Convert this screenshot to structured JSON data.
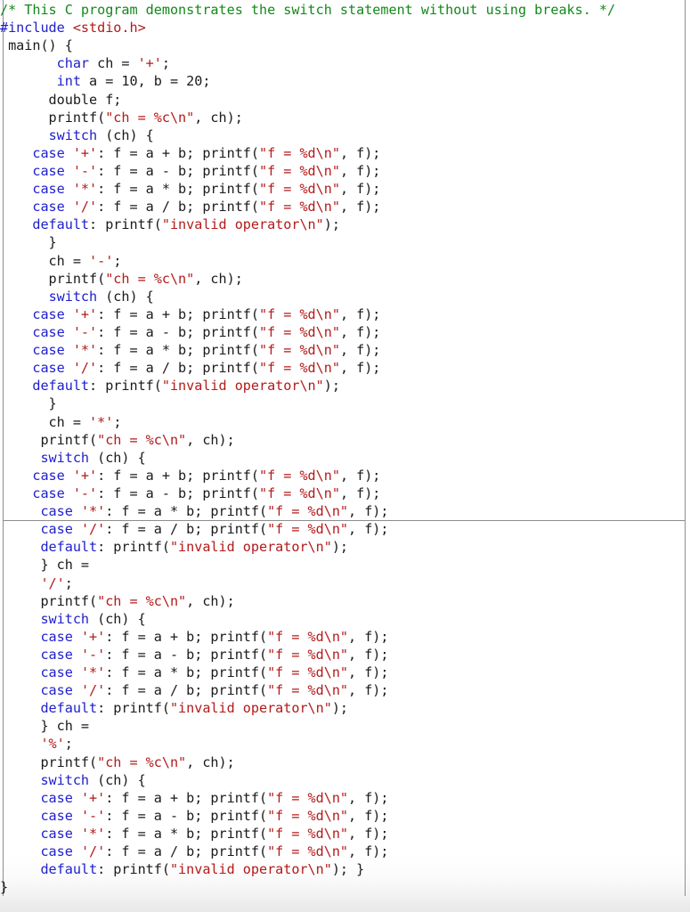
{
  "document": {
    "kind": "source-code-listing",
    "language": "C",
    "page_break_after_line_index": 28
  },
  "theme": {
    "background": "#ffffff",
    "foreground": "#1a1a1a",
    "keyword": "#2020cd",
    "string": "#b31a1a",
    "comment": "#13891a",
    "preprocessor": "#2020cd",
    "rule": "#8d8d8d"
  },
  "code": {
    "lines": [
      [
        {
          "t": "comment",
          "s": "/* This C program demonstrates the switch statement without using breaks. */"
        }
      ],
      [
        {
          "t": "pp",
          "s": "#include"
        },
        {
          "t": "plain",
          "s": " "
        },
        {
          "t": "str",
          "s": "<stdio.h>"
        }
      ],
      [
        {
          "t": "plain",
          "s": " main() {"
        }
      ],
      [
        {
          "t": "plain",
          "s": "       "
        },
        {
          "t": "kw",
          "s": "char"
        },
        {
          "t": "plain",
          "s": " ch = "
        },
        {
          "t": "str",
          "s": "'+'"
        },
        {
          "t": "plain",
          "s": ";"
        }
      ],
      [
        {
          "t": "plain",
          "s": "       "
        },
        {
          "t": "kw",
          "s": "int"
        },
        {
          "t": "plain",
          "s": " a = 10, b = 20;"
        }
      ],
      [
        {
          "t": "plain",
          "s": "      double f;"
        }
      ],
      [
        {
          "t": "plain",
          "s": "      printf("
        },
        {
          "t": "str",
          "s": "\"ch = %c\\n\""
        },
        {
          "t": "plain",
          "s": ", ch);"
        }
      ],
      [
        {
          "t": "plain",
          "s": "      "
        },
        {
          "t": "kw",
          "s": "switch"
        },
        {
          "t": "plain",
          "s": " (ch) {"
        }
      ],
      [
        {
          "t": "plain",
          "s": "    "
        },
        {
          "t": "kw",
          "s": "case"
        },
        {
          "t": "plain",
          "s": " "
        },
        {
          "t": "str",
          "s": "'+'"
        },
        {
          "t": "plain",
          "s": ": f = a + b; printf("
        },
        {
          "t": "str",
          "s": "\"f = %d\\n\""
        },
        {
          "t": "plain",
          "s": ", f);"
        }
      ],
      [
        {
          "t": "plain",
          "s": "    "
        },
        {
          "t": "kw",
          "s": "case"
        },
        {
          "t": "plain",
          "s": " "
        },
        {
          "t": "str",
          "s": "'-'"
        },
        {
          "t": "plain",
          "s": ": f = a - b; printf("
        },
        {
          "t": "str",
          "s": "\"f = %d\\n\""
        },
        {
          "t": "plain",
          "s": ", f);"
        }
      ],
      [
        {
          "t": "plain",
          "s": "    "
        },
        {
          "t": "kw",
          "s": "case"
        },
        {
          "t": "plain",
          "s": " "
        },
        {
          "t": "str",
          "s": "'*'"
        },
        {
          "t": "plain",
          "s": ": f = a * b; printf("
        },
        {
          "t": "str",
          "s": "\"f = %d\\n\""
        },
        {
          "t": "plain",
          "s": ", f);"
        }
      ],
      [
        {
          "t": "plain",
          "s": "    "
        },
        {
          "t": "kw",
          "s": "case"
        },
        {
          "t": "plain",
          "s": " "
        },
        {
          "t": "str",
          "s": "'/'"
        },
        {
          "t": "plain",
          "s": ": f = a / b; printf("
        },
        {
          "t": "str",
          "s": "\"f = %d\\n\""
        },
        {
          "t": "plain",
          "s": ", f);"
        }
      ],
      [
        {
          "t": "plain",
          "s": "    "
        },
        {
          "t": "kw",
          "s": "default"
        },
        {
          "t": "plain",
          "s": ": printf("
        },
        {
          "t": "str",
          "s": "\"invalid operator\\n\""
        },
        {
          "t": "plain",
          "s": ");"
        }
      ],
      [
        {
          "t": "plain",
          "s": "      }"
        }
      ],
      [
        {
          "t": "plain",
          "s": "      ch = "
        },
        {
          "t": "str",
          "s": "'-'"
        },
        {
          "t": "plain",
          "s": ";"
        }
      ],
      [
        {
          "t": "plain",
          "s": "      printf("
        },
        {
          "t": "str",
          "s": "\"ch = %c\\n\""
        },
        {
          "t": "plain",
          "s": ", ch);"
        }
      ],
      [
        {
          "t": "plain",
          "s": "      "
        },
        {
          "t": "kw",
          "s": "switch"
        },
        {
          "t": "plain",
          "s": " (ch) {"
        }
      ],
      [
        {
          "t": "plain",
          "s": "    "
        },
        {
          "t": "kw",
          "s": "case"
        },
        {
          "t": "plain",
          "s": " "
        },
        {
          "t": "str",
          "s": "'+'"
        },
        {
          "t": "plain",
          "s": ": f = a + b; printf("
        },
        {
          "t": "str",
          "s": "\"f = %d\\n\""
        },
        {
          "t": "plain",
          "s": ", f);"
        }
      ],
      [
        {
          "t": "plain",
          "s": "    "
        },
        {
          "t": "kw",
          "s": "case"
        },
        {
          "t": "plain",
          "s": " "
        },
        {
          "t": "str",
          "s": "'-'"
        },
        {
          "t": "plain",
          "s": ": f = a - b; printf("
        },
        {
          "t": "str",
          "s": "\"f = %d\\n\""
        },
        {
          "t": "plain",
          "s": ", f);"
        }
      ],
      [
        {
          "t": "plain",
          "s": "    "
        },
        {
          "t": "kw",
          "s": "case"
        },
        {
          "t": "plain",
          "s": " "
        },
        {
          "t": "str",
          "s": "'*'"
        },
        {
          "t": "plain",
          "s": ": f = a * b; printf("
        },
        {
          "t": "str",
          "s": "\"f = %d\\n\""
        },
        {
          "t": "plain",
          "s": ", f);"
        }
      ],
      [
        {
          "t": "plain",
          "s": "    "
        },
        {
          "t": "kw",
          "s": "case"
        },
        {
          "t": "plain",
          "s": " "
        },
        {
          "t": "str",
          "s": "'/'"
        },
        {
          "t": "plain",
          "s": ": f = a / b; printf("
        },
        {
          "t": "str",
          "s": "\"f = %d\\n\""
        },
        {
          "t": "plain",
          "s": ", f);"
        }
      ],
      [
        {
          "t": "plain",
          "s": "    "
        },
        {
          "t": "kw",
          "s": "default"
        },
        {
          "t": "plain",
          "s": ": printf("
        },
        {
          "t": "str",
          "s": "\"invalid operator\\n\""
        },
        {
          "t": "plain",
          "s": ");"
        }
      ],
      [
        {
          "t": "plain",
          "s": "      }"
        }
      ],
      [
        {
          "t": "plain",
          "s": "      ch = "
        },
        {
          "t": "str",
          "s": "'*'"
        },
        {
          "t": "plain",
          "s": ";"
        }
      ],
      [
        {
          "t": "plain",
          "s": "     printf("
        },
        {
          "t": "str",
          "s": "\"ch = %c\\n\""
        },
        {
          "t": "plain",
          "s": ", ch);"
        }
      ],
      [
        {
          "t": "plain",
          "s": "     "
        },
        {
          "t": "kw",
          "s": "switch"
        },
        {
          "t": "plain",
          "s": " (ch) {"
        }
      ],
      [
        {
          "t": "plain",
          "s": "    "
        },
        {
          "t": "kw",
          "s": "case"
        },
        {
          "t": "plain",
          "s": " "
        },
        {
          "t": "str",
          "s": "'+'"
        },
        {
          "t": "plain",
          "s": ": f = a + b; printf("
        },
        {
          "t": "str",
          "s": "\"f = %d\\n\""
        },
        {
          "t": "plain",
          "s": ", f);"
        }
      ],
      [
        {
          "t": "plain",
          "s": "    "
        },
        {
          "t": "kw",
          "s": "case"
        },
        {
          "t": "plain",
          "s": " "
        },
        {
          "t": "str",
          "s": "'-'"
        },
        {
          "t": "plain",
          "s": ": f = a - b; printf("
        },
        {
          "t": "str",
          "s": "\"f = %d\\n\""
        },
        {
          "t": "plain",
          "s": ", f);"
        }
      ],
      [
        {
          "t": "plain",
          "s": "     "
        },
        {
          "t": "kw",
          "s": "case"
        },
        {
          "t": "plain",
          "s": " "
        },
        {
          "t": "str",
          "s": "'*'"
        },
        {
          "t": "plain",
          "s": ": f = a * b; printf("
        },
        {
          "t": "str",
          "s": "\"f = %d\\n\""
        },
        {
          "t": "plain",
          "s": ", f);"
        }
      ],
      [
        {
          "t": "plain",
          "s": "     "
        },
        {
          "t": "kw",
          "s": "case"
        },
        {
          "t": "plain",
          "s": " "
        },
        {
          "t": "str",
          "s": "'/'"
        },
        {
          "t": "plain",
          "s": ": f = a / b; printf("
        },
        {
          "t": "str",
          "s": "\"f = %d\\n\""
        },
        {
          "t": "plain",
          "s": ", f);"
        }
      ],
      [
        {
          "t": "plain",
          "s": "     "
        },
        {
          "t": "kw",
          "s": "default"
        },
        {
          "t": "plain",
          "s": ": printf("
        },
        {
          "t": "str",
          "s": "\"invalid operator\\n\""
        },
        {
          "t": "plain",
          "s": ");"
        }
      ],
      [
        {
          "t": "plain",
          "s": "     } ch ="
        }
      ],
      [
        {
          "t": "plain",
          "s": "     "
        },
        {
          "t": "str",
          "s": "'/'"
        },
        {
          "t": "plain",
          "s": ";"
        }
      ],
      [
        {
          "t": "plain",
          "s": "     printf("
        },
        {
          "t": "str",
          "s": "\"ch = %c\\n\""
        },
        {
          "t": "plain",
          "s": ", ch);"
        }
      ],
      [
        {
          "t": "plain",
          "s": "     "
        },
        {
          "t": "kw",
          "s": "switch"
        },
        {
          "t": "plain",
          "s": " (ch) {"
        }
      ],
      [
        {
          "t": "plain",
          "s": "     "
        },
        {
          "t": "kw",
          "s": "case"
        },
        {
          "t": "plain",
          "s": " "
        },
        {
          "t": "str",
          "s": "'+'"
        },
        {
          "t": "plain",
          "s": ": f = a + b; printf("
        },
        {
          "t": "str",
          "s": "\"f = %d\\n\""
        },
        {
          "t": "plain",
          "s": ", f);"
        }
      ],
      [
        {
          "t": "plain",
          "s": "     "
        },
        {
          "t": "kw",
          "s": "case"
        },
        {
          "t": "plain",
          "s": " "
        },
        {
          "t": "str",
          "s": "'-'"
        },
        {
          "t": "plain",
          "s": ": f = a - b; printf("
        },
        {
          "t": "str",
          "s": "\"f = %d\\n\""
        },
        {
          "t": "plain",
          "s": ", f);"
        }
      ],
      [
        {
          "t": "plain",
          "s": "     "
        },
        {
          "t": "kw",
          "s": "case"
        },
        {
          "t": "plain",
          "s": " "
        },
        {
          "t": "str",
          "s": "'*'"
        },
        {
          "t": "plain",
          "s": ": f = a * b; printf("
        },
        {
          "t": "str",
          "s": "\"f = %d\\n\""
        },
        {
          "t": "plain",
          "s": ", f);"
        }
      ],
      [
        {
          "t": "plain",
          "s": "     "
        },
        {
          "t": "kw",
          "s": "case"
        },
        {
          "t": "plain",
          "s": " "
        },
        {
          "t": "str",
          "s": "'/'"
        },
        {
          "t": "plain",
          "s": ": f = a / b; printf("
        },
        {
          "t": "str",
          "s": "\"f = %d\\n\""
        },
        {
          "t": "plain",
          "s": ", f);"
        }
      ],
      [
        {
          "t": "plain",
          "s": "     "
        },
        {
          "t": "kw",
          "s": "default"
        },
        {
          "t": "plain",
          "s": ": printf("
        },
        {
          "t": "str",
          "s": "\"invalid operator\\n\""
        },
        {
          "t": "plain",
          "s": ");"
        }
      ],
      [
        {
          "t": "plain",
          "s": "     } ch ="
        }
      ],
      [
        {
          "t": "plain",
          "s": "     "
        },
        {
          "t": "str",
          "s": "'%'"
        },
        {
          "t": "plain",
          "s": ";"
        }
      ],
      [
        {
          "t": "plain",
          "s": "     printf("
        },
        {
          "t": "str",
          "s": "\"ch = %c\\n\""
        },
        {
          "t": "plain",
          "s": ", ch);"
        }
      ],
      [
        {
          "t": "plain",
          "s": "     "
        },
        {
          "t": "kw",
          "s": "switch"
        },
        {
          "t": "plain",
          "s": " (ch) {"
        }
      ],
      [
        {
          "t": "plain",
          "s": "     "
        },
        {
          "t": "kw",
          "s": "case"
        },
        {
          "t": "plain",
          "s": " "
        },
        {
          "t": "str",
          "s": "'+'"
        },
        {
          "t": "plain",
          "s": ": f = a + b; printf("
        },
        {
          "t": "str",
          "s": "\"f = %d\\n\""
        },
        {
          "t": "plain",
          "s": ", f);"
        }
      ],
      [
        {
          "t": "plain",
          "s": "     "
        },
        {
          "t": "kw",
          "s": "case"
        },
        {
          "t": "plain",
          "s": " "
        },
        {
          "t": "str",
          "s": "'-'"
        },
        {
          "t": "plain",
          "s": ": f = a - b; printf("
        },
        {
          "t": "str",
          "s": "\"f = %d\\n\""
        },
        {
          "t": "plain",
          "s": ", f);"
        }
      ],
      [
        {
          "t": "plain",
          "s": "     "
        },
        {
          "t": "kw",
          "s": "case"
        },
        {
          "t": "plain",
          "s": " "
        },
        {
          "t": "str",
          "s": "'*'"
        },
        {
          "t": "plain",
          "s": ": f = a * b; printf("
        },
        {
          "t": "str",
          "s": "\"f = %d\\n\""
        },
        {
          "t": "plain",
          "s": ", f);"
        }
      ],
      [
        {
          "t": "plain",
          "s": "     "
        },
        {
          "t": "kw",
          "s": "case"
        },
        {
          "t": "plain",
          "s": " "
        },
        {
          "t": "str",
          "s": "'/'"
        },
        {
          "t": "plain",
          "s": ": f = a / b; printf("
        },
        {
          "t": "str",
          "s": "\"f = %d\\n\""
        },
        {
          "t": "plain",
          "s": ", f);"
        }
      ],
      [
        {
          "t": "plain",
          "s": "     "
        },
        {
          "t": "kw",
          "s": "default"
        },
        {
          "t": "plain",
          "s": ": printf("
        },
        {
          "t": "str",
          "s": "\"invalid operator\\n\""
        },
        {
          "t": "plain",
          "s": "); }"
        }
      ],
      [
        {
          "t": "plain",
          "s": "}"
        }
      ]
    ]
  }
}
